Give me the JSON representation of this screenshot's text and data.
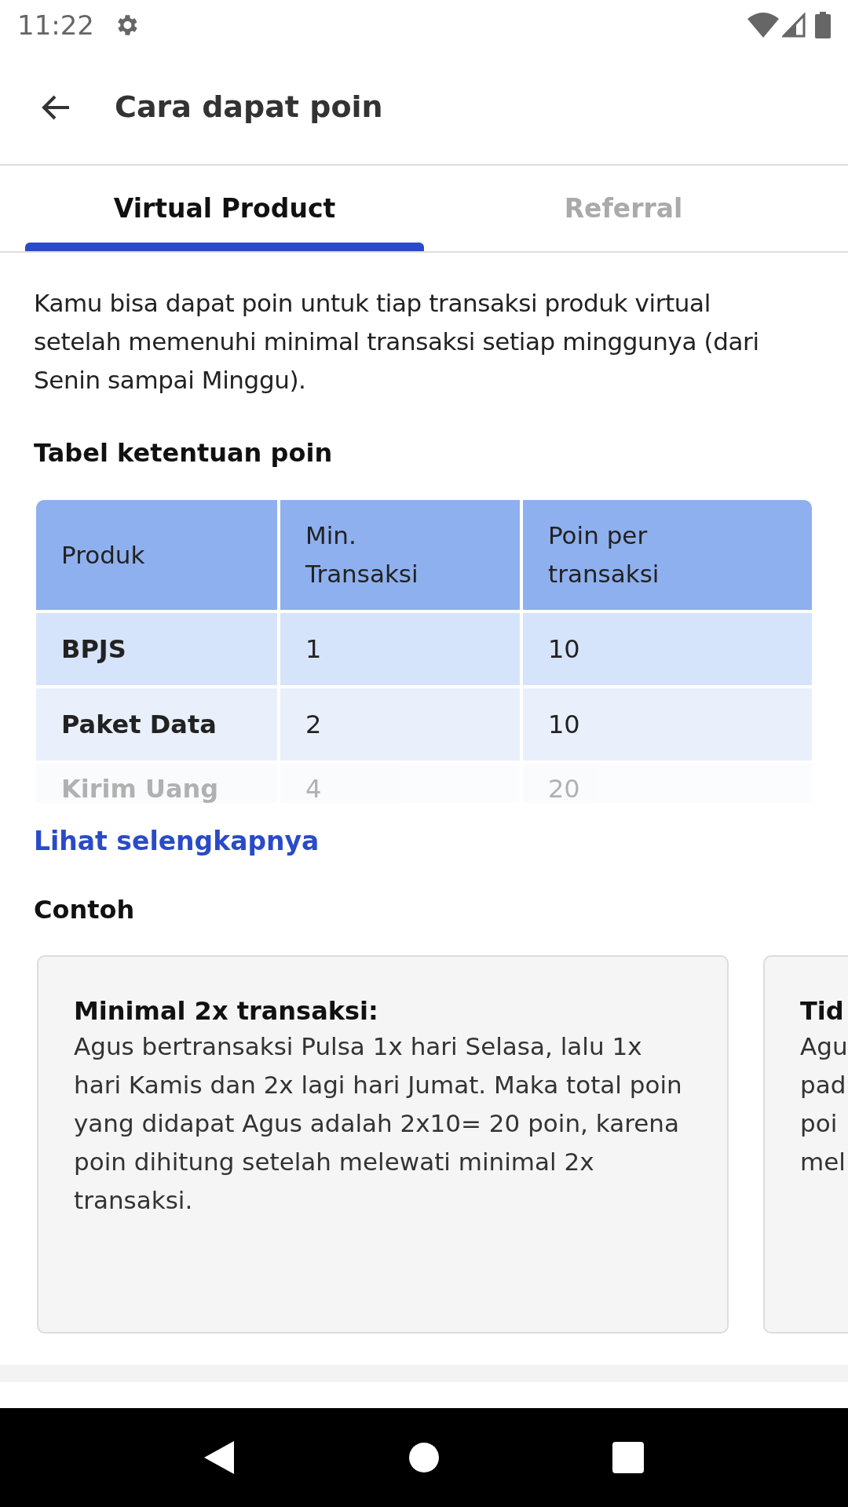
{
  "status_bar": {
    "time": "11:22"
  },
  "header": {
    "title": "Cara dapat poin"
  },
  "tabs": [
    {
      "label": "Virtual Product",
      "selected": true
    },
    {
      "label": "Referral",
      "selected": false
    }
  ],
  "intro": "Kamu bisa dapat poin untuk tiap transaksi produk virtual setelah memenuhi minimal transaksi setiap minggunya (dari Senin sampai Minggu).",
  "table_title": "Tabel ketentuan poin",
  "table": {
    "columns": [
      "Produk",
      "Min. Transaksi",
      "Poin per transaksi"
    ],
    "rows": [
      [
        "BPJS",
        "1",
        "10"
      ],
      [
        "Paket Data",
        "2",
        "10"
      ],
      [
        "Kirim Uang",
        "4",
        "20"
      ]
    ]
  },
  "more_link": "Lihat selengkapnya",
  "examples_title": "Contoh",
  "examples": [
    {
      "title": "Minimal 2x transaksi:",
      "body": "Agus bertransaksi Pulsa 1x hari Selasa, lalu 1x hari Kamis dan 2x lagi hari Jumat. Maka total poin yang didapat Agus adalah 2x10= 20 poin, karena poin dihitung setelah melewati minimal 2x transaksi."
    },
    {
      "title": "Tid",
      "lines": [
        "Agu",
        "pad",
        "poi",
        "mel"
      ]
    }
  ]
}
